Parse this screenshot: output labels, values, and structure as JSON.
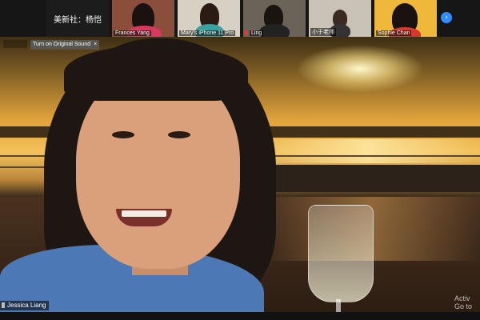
{
  "participants": [
    {
      "name": "美新社：杨恺",
      "kind": "name-only"
    },
    {
      "name": "Frances Yang",
      "kind": "video"
    },
    {
      "name": "Mary's iPhone 11 Pro",
      "kind": "video"
    },
    {
      "name": "Ling",
      "kind": "video"
    },
    {
      "name": "小于老师",
      "kind": "video"
    },
    {
      "name": "Sophie Chan",
      "kind": "video"
    }
  ],
  "gallery_next_icon": "›",
  "notice": {
    "text": "Turn on Original Sound",
    "close": "×"
  },
  "active_speaker": {
    "name": "Jessica Liang"
  },
  "watermark": {
    "line1": "Activ",
    "line2": "Go to"
  },
  "colors": {
    "accent": "#2d8cff",
    "mic_muted": "#e33333"
  }
}
